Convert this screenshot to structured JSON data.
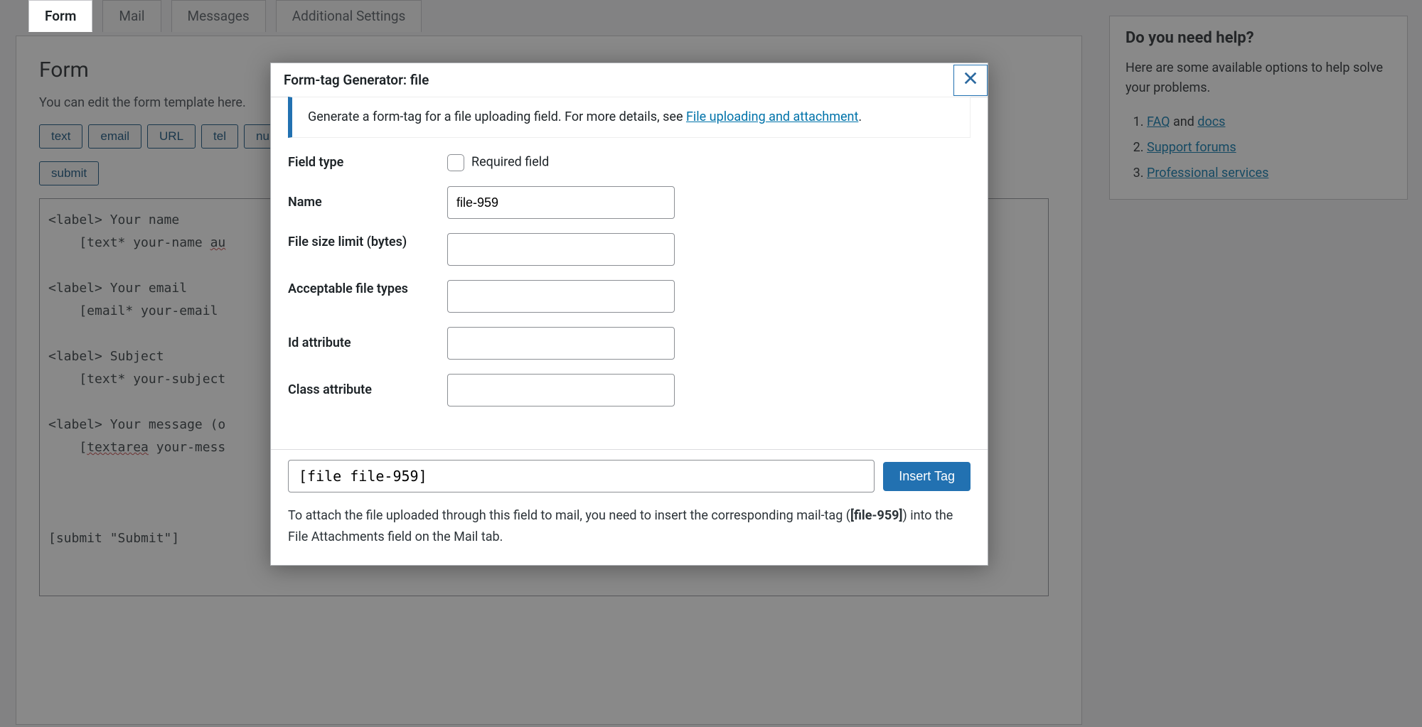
{
  "tabs": {
    "form": "Form",
    "mail": "Mail",
    "messages": "Messages",
    "additional": "Additional Settings"
  },
  "form_panel": {
    "title": "Form",
    "hint": "You can edit the form template here.",
    "tag_buttons": {
      "text": "text",
      "email": "email",
      "url": "URL",
      "tel": "tel",
      "number_trunc": "nu",
      "submit": "submit"
    },
    "code_line1": "<label> Your name",
    "code_line2a": "    [text* your-name ",
    "code_line2b": "au",
    "code_line3": "<label> Your email",
    "code_line4": "    [email* your-email ",
    "code_line5": "<label> Subject",
    "code_line6": "    [text* your-subject",
    "code_line7": "<label> Your message (o",
    "code_line8a": "    [",
    "code_line8b": "textarea",
    "code_line8c": " your-mess",
    "code_line9": "[submit \"Submit\"]"
  },
  "help": {
    "title": "Do you need help?",
    "intro": "Here are some available options to help solve your problems.",
    "faq_link": "FAQ",
    "and_word": " and ",
    "docs_link": "docs",
    "support_link": "Support forums",
    "pro_link": "Professional services"
  },
  "modal": {
    "title": "Form-tag Generator: file",
    "info_pre": "Generate a form-tag for a file uploading field. For more details, see ",
    "info_link": "File uploading and attachment",
    "info_post": ".",
    "labels": {
      "field_type": "Field type",
      "required": "Required field",
      "name": "Name",
      "size_limit": "File size limit (bytes)",
      "file_types": "Acceptable file types",
      "id_attr": "Id attribute",
      "class_attr": "Class attribute"
    },
    "values": {
      "name": "file-959",
      "size_limit": "",
      "file_types": "",
      "id_attr": "",
      "class_attr": ""
    },
    "generated_code": "[file file-959]",
    "insert_label": "Insert Tag",
    "footer_note_pre": "To attach the file uploaded through this field to mail, you need to insert the corresponding mail-tag (",
    "footer_note_bold": "[file-959]",
    "footer_note_post": ") into the File Attachments field on the Mail tab."
  }
}
